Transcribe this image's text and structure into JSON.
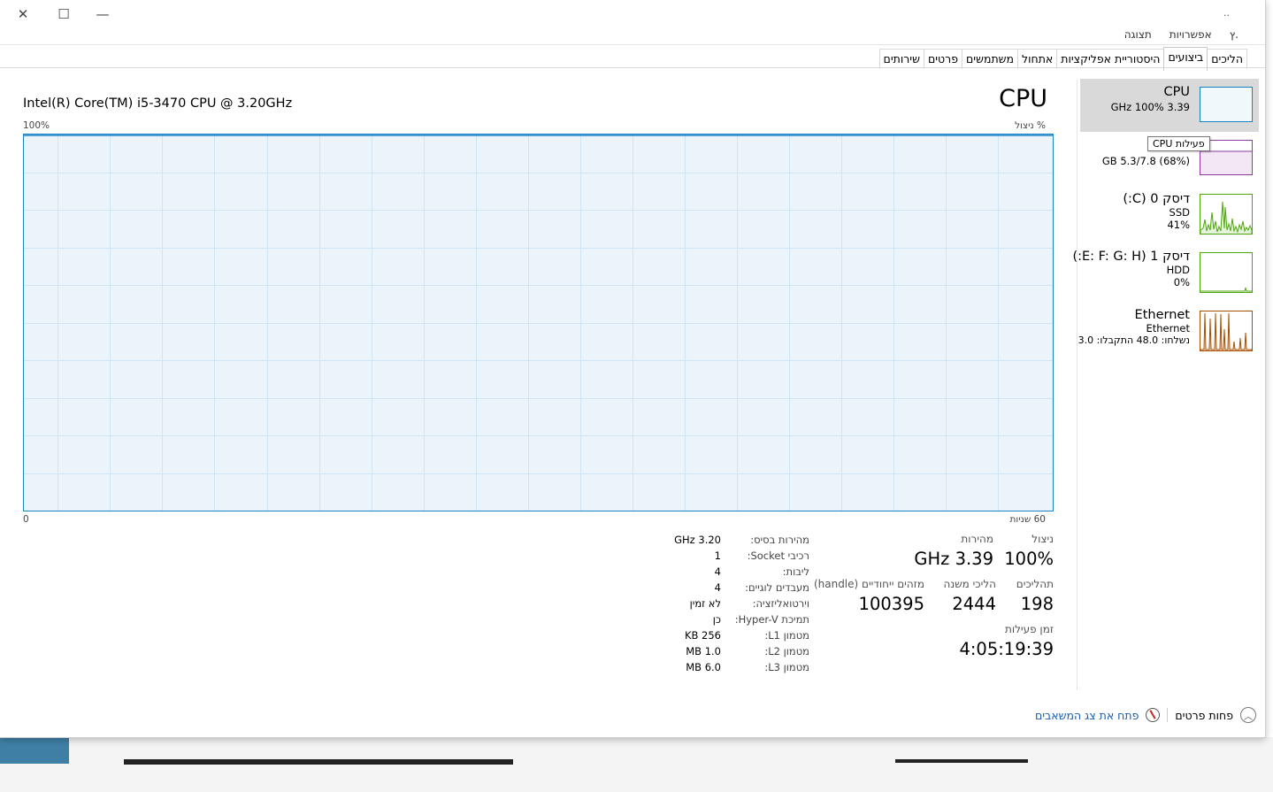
{
  "window": {
    "controls": {
      "close": "✕",
      "maximize": "☐",
      "minimize": "—"
    },
    "title_fragment": ".."
  },
  "menu": [
    "ץ.",
    "אפשרויות",
    "תצוגה"
  ],
  "tabs": [
    {
      "label": "הליכים",
      "active": false
    },
    {
      "label": "ביצועים",
      "active": true
    },
    {
      "label": "היסטוריית אפליקציות",
      "active": false
    },
    {
      "label": "אתחול",
      "active": false
    },
    {
      "label": "משתמשים",
      "active": false
    },
    {
      "label": "פרטים",
      "active": false
    },
    {
      "label": "שירותים",
      "active": false
    }
  ],
  "main": {
    "cpu_model": "Intel(R) Core(TM) i5-3470 CPU @ 3.20GHz",
    "title": "CPU",
    "y_max_label": "100%",
    "y_title": "% ניצול",
    "x_start_label": "0",
    "x_end_label": "60 שניות"
  },
  "chart_data": {
    "type": "area",
    "title": "CPU",
    "ylabel": "% ניצול",
    "xlabel": "60 שניות",
    "ylim": [
      0,
      100
    ],
    "grid": true,
    "series": [
      {
        "values": [
          100,
          100,
          100,
          100,
          100,
          100,
          100,
          100,
          100,
          100,
          100,
          100,
          100,
          100,
          100,
          100,
          100,
          100,
          100,
          100,
          100
        ]
      }
    ]
  },
  "stats": {
    "utilization": {
      "label": "ניצול",
      "value": "100%"
    },
    "speed": {
      "label": "מהירות",
      "value": "3.39 GHz"
    },
    "processes": {
      "label": "תהליכים",
      "value": "198"
    },
    "threads": {
      "label": "הליכי משנה",
      "value": "2444"
    },
    "handles": {
      "label": "מזהים ייחודיים (handle)",
      "value": "100395"
    },
    "uptime": {
      "label": "זמן פעילות",
      "value": "4:05:19:39"
    }
  },
  "info": [
    {
      "label": "מהירות בסיס:",
      "value": "3.20 GHz"
    },
    {
      "label": "רכיבי Socket:",
      "value": "1"
    },
    {
      "label": "ליבות:",
      "value": "4"
    },
    {
      "label": "מעבדים לוגיים:",
      "value": "4"
    },
    {
      "label": "וירטואליזציה:",
      "value": "לא זמין"
    },
    {
      "label": "תמיכת Hyper-V:",
      "value": "כן"
    },
    {
      "label": "מטמון L1:",
      "value": "256 KB"
    },
    {
      "label": "מטמון L2:",
      "value": "1.0 MB"
    },
    {
      "label": "מטמון L3:",
      "value": "6.0 MB"
    }
  ],
  "sidebar": {
    "cpu": {
      "name": "CPU",
      "detail": "3.39 GHz  100%",
      "color": "#1782c6"
    },
    "memory": {
      "detail": "(68%) 5.3/7.8 GB",
      "color": "#8e3a9e"
    },
    "disk0": {
      "name": "דיסק 0 (C:)",
      "type": "SSD",
      "usage": "41%",
      "color": "#4da60c"
    },
    "disk1": {
      "name": "דיסק 1 (E: F: G: H:)",
      "type": "HDD",
      "usage": "0%",
      "color": "#4da60c"
    },
    "ethernet": {
      "name": "Ethernet",
      "sub": "Ethernet",
      "detail": "נשלחו: 48.0  התקבלו: 3.0",
      "color": "#a74f01"
    }
  },
  "tooltip": "פעילות CPU",
  "bottom": {
    "fewer_details": "פחות פרטים",
    "open_monitor": "פתח את צג המשאבים"
  }
}
